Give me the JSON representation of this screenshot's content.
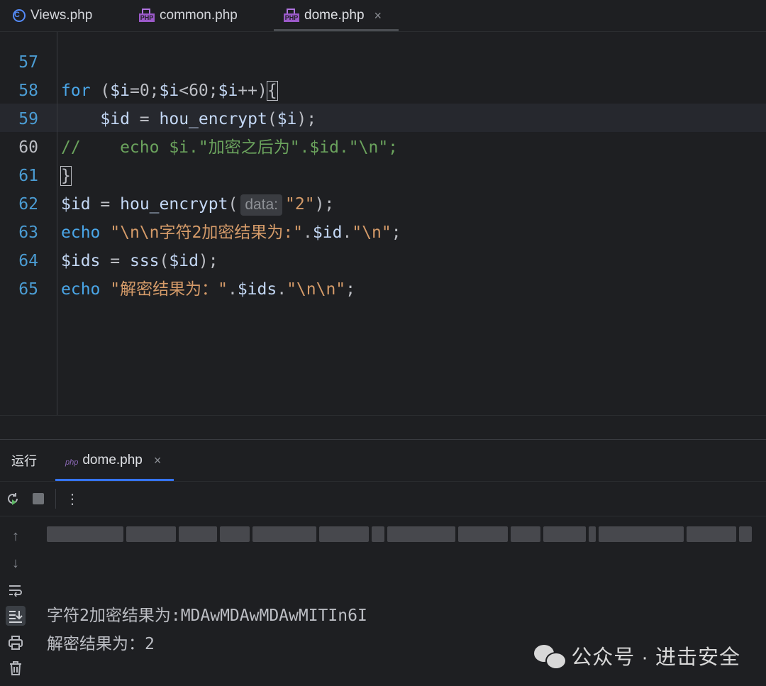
{
  "tabs": [
    {
      "label": "Views.php",
      "icon": "c-class-icon"
    },
    {
      "label": "common.php",
      "icon": "php-file-icon"
    },
    {
      "label": "dome.php",
      "icon": "php-file-icon",
      "close": "×"
    }
  ],
  "editor": {
    "lines": [
      {
        "num": "57",
        "code": "for ($i=0;$i<60;$i++){"
      },
      {
        "num": "58",
        "code": "    $id = hou_encrypt($i);"
      },
      {
        "num": "59",
        "code": "//    echo $i.\"加密之后为\".$id.\"\\n\";"
      },
      {
        "num": "60",
        "code": "}"
      },
      {
        "num": "61",
        "code": "$id = hou_encrypt( data: \"2\");"
      },
      {
        "num": "62",
        "code": "echo \"\\n\\n字符2加密结果为:\".$id.\"\\n\";"
      },
      {
        "num": "63",
        "code": "$ids = sss($id);"
      },
      {
        "num": "64",
        "code": "echo \"解密结果为：\".$ids.\"\\n\\n\";"
      },
      {
        "num": "65",
        "code": ""
      }
    ],
    "param_hint": "data:"
  },
  "run_panel": {
    "title": "运行",
    "tab_label": "dome.php",
    "tab_close": "×",
    "output_lines": [
      "字符2加密结果为:MDAwMDAwMDAwMITIn6I",
      "解密结果为：2"
    ]
  },
  "watermark": {
    "text": "公众号 · 进击安全"
  }
}
